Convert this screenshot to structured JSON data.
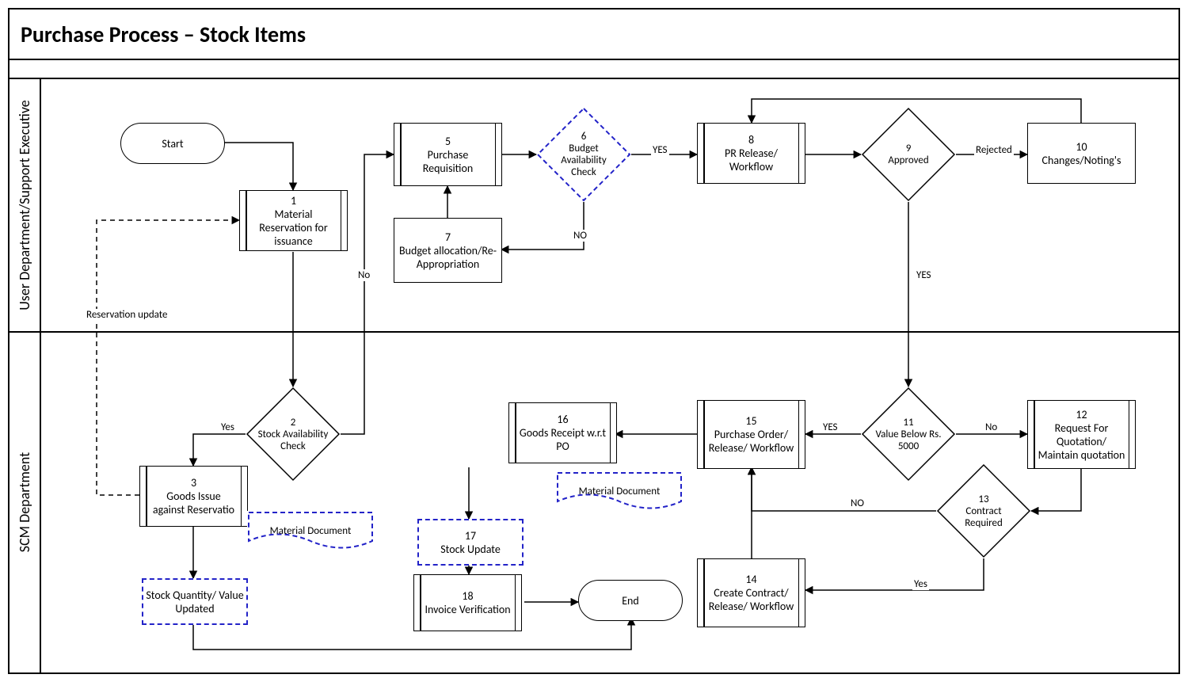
{
  "title": "Purchase Process – Stock Items",
  "lanes": {
    "top": "User Department/Support Executive",
    "bot": "SCM Department"
  },
  "nodes": {
    "start": "Start",
    "n1": {
      "num": "1",
      "label": "Material Reservation for issuance"
    },
    "n2": {
      "num": "2",
      "label": "Stock Availability Check"
    },
    "n3": {
      "num": "3",
      "label": "Goods Issue against Reservatio"
    },
    "stockqty": "Stock Quantity/ Value Updated",
    "matdoc1": "Material Document",
    "n5": {
      "num": "5",
      "label": "Purchase Requisition"
    },
    "n6": {
      "num": "6",
      "label": "Budget Availability Check"
    },
    "n7": {
      "num": "7",
      "label": "Budget allocation/Re-Appropriation"
    },
    "n8": {
      "num": "8",
      "label": "PR Release/ Workflow"
    },
    "n9": {
      "num": "9",
      "label": "Approved"
    },
    "n10": {
      "num": "10",
      "label": "Changes/Noting's"
    },
    "n11": {
      "num": "11",
      "label": "Value Below Rs. 5000"
    },
    "n12": {
      "num": "12",
      "label": "Request For Quotation/ Maintain quotation"
    },
    "n13": {
      "num": "13",
      "label": "Contract Required"
    },
    "n14": {
      "num": "14",
      "label": "Create Contract/ Release/ Workflow"
    },
    "n15": {
      "num": "15",
      "label": "Purchase Order/ Release/ Workflow"
    },
    "n16": {
      "num": "16",
      "label": "Goods Receipt w.r.t PO"
    },
    "matdoc2": "Material Document",
    "n17": {
      "num": "17",
      "label": "Stock Update"
    },
    "n18": {
      "num": "18",
      "label": "Invoice Verification"
    },
    "end": "End"
  },
  "edges": {
    "resupdate": "Reservation update",
    "yes": "Yes",
    "YES": "YES",
    "no": "No",
    "NO": "NO",
    "rejected": "Rejected"
  }
}
